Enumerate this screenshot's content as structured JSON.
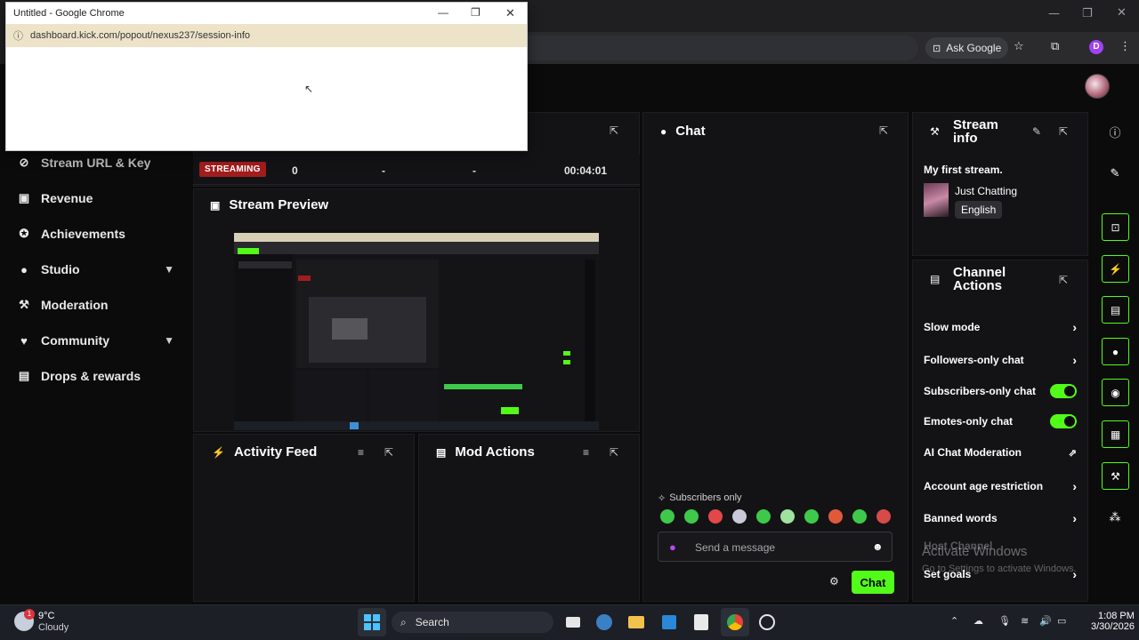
{
  "main_browser": {
    "ask_google": "Ask Google",
    "profile_initial": "D"
  },
  "popup": {
    "title": "Untitled - Google Chrome",
    "url": "dashboard.kick.com/popout/nexus237/session-info"
  },
  "sidebar": {
    "items": [
      {
        "label": "Stream URL & Key",
        "icon": "link-icon"
      },
      {
        "label": "Revenue",
        "icon": "revenue-icon"
      },
      {
        "label": "Achievements",
        "icon": "trophy-icon"
      },
      {
        "label": "Studio",
        "icon": "studio-icon",
        "expandable": true
      },
      {
        "label": "Moderation",
        "icon": "wrench-icon"
      },
      {
        "label": "Community",
        "icon": "community-icon",
        "expandable": true
      },
      {
        "label": "Drops & rewards",
        "icon": "drops-icon"
      }
    ]
  },
  "session": {
    "status": "STREAMING",
    "viewers": "0",
    "stat2": "-",
    "stat3": "-",
    "duration": "00:04:01"
  },
  "stream_preview": {
    "title": "Stream Preview"
  },
  "activity_feed": {
    "title": "Activity Feed"
  },
  "mod_actions": {
    "title": "Mod Actions"
  },
  "chat": {
    "title": "Chat",
    "mode_notice": "Subscribers only",
    "placeholder": "Send a message",
    "send_label": "Chat"
  },
  "stream_info": {
    "title_line1": "Stream",
    "title_line2": "info",
    "stream_title": "My first stream.",
    "category": "Just Chatting",
    "language": "English"
  },
  "channel_actions": {
    "title_line1": "Channel",
    "title_line2": "Actions",
    "rows": [
      {
        "label": "Slow mode",
        "control": "chevron"
      },
      {
        "label": "Followers-only chat",
        "control": "chevron"
      },
      {
        "label": "Subscribers-only chat",
        "control": "toggle-on"
      },
      {
        "label": "Emotes-only chat",
        "control": "toggle-on"
      },
      {
        "label": "AI Chat Moderation",
        "control": "external"
      },
      {
        "label": "Account age restriction",
        "control": "chevron"
      },
      {
        "label": "Banned words",
        "control": "chevron"
      },
      {
        "label": "Host Channel",
        "control": "none"
      },
      {
        "label": "Set goals",
        "control": "chevron"
      }
    ]
  },
  "watermark": {
    "line1": "Activate Windows",
    "line2": "Go to Settings to activate Windows."
  },
  "taskbar": {
    "weather_temp": "9°C",
    "weather_desc": "Cloudy",
    "weather_badge": "1",
    "search": "Search",
    "time": "1:08 PM",
    "date": "3/30/2026"
  },
  "colors": {
    "accent": "#53fc18",
    "streaming": "#a11d1d",
    "panel": "#131316",
    "background": "#0b0b0c"
  }
}
